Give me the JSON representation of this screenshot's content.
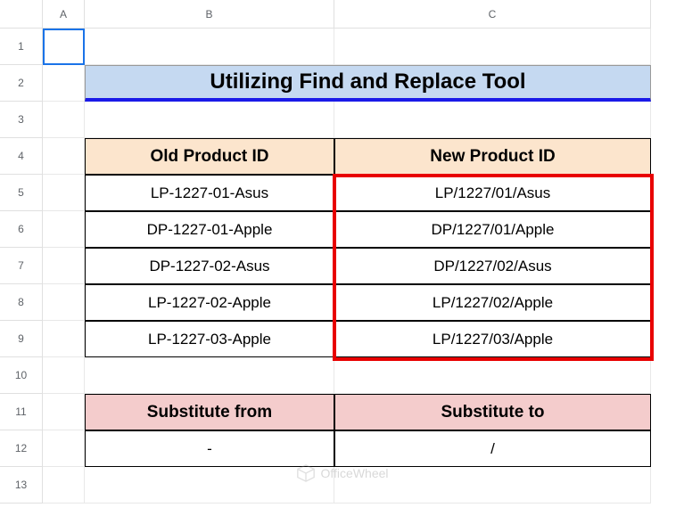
{
  "columns": [
    "A",
    "B",
    "C"
  ],
  "rows": [
    "1",
    "2",
    "3",
    "4",
    "5",
    "6",
    "7",
    "8",
    "9",
    "10",
    "11",
    "12",
    "13"
  ],
  "title": "Utilizing Find and Replace Tool",
  "headers": {
    "old": "Old Product ID",
    "new": "New Product ID"
  },
  "data_rows": [
    {
      "old": "LP-1227-01-Asus",
      "new": "LP/1227/01/Asus"
    },
    {
      "old": "DP-1227-01-Apple",
      "new": "DP/1227/01/Apple"
    },
    {
      "old": "DP-1227-02-Asus",
      "new": "DP/1227/02/Asus"
    },
    {
      "old": "LP-1227-02-Apple",
      "new": "LP/1227/02/Apple"
    },
    {
      "old": "LP-1227-03-Apple",
      "new": "LP/1227/03/Apple"
    }
  ],
  "sub_headers": {
    "from": "Substitute from",
    "to": "Substitute to"
  },
  "sub_values": {
    "from": "-",
    "to": "/"
  },
  "watermark": "OfficeWheel"
}
